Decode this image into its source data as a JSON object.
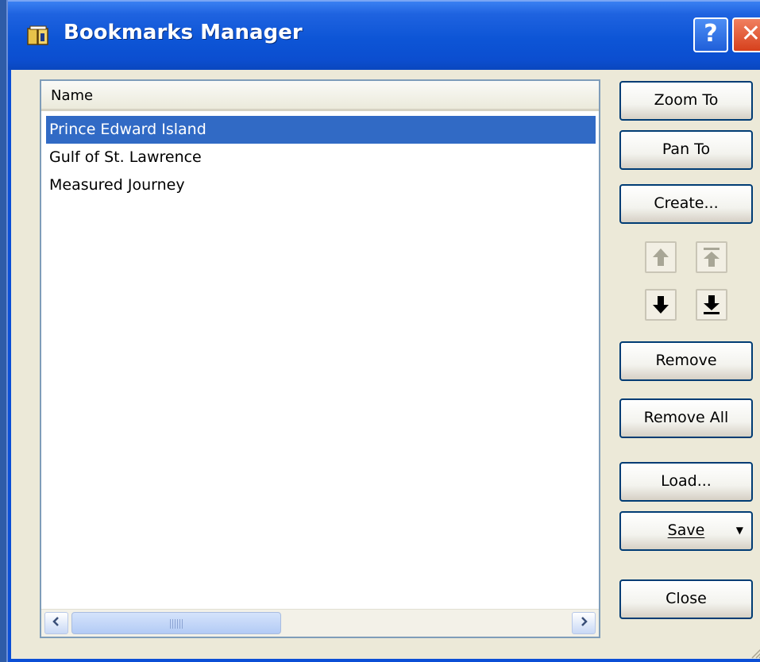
{
  "window": {
    "title": "Bookmarks Manager",
    "help_glyph": "?",
    "close_glyph": "✕"
  },
  "list": {
    "header": "Name",
    "items": [
      {
        "label": "Prince Edward Island",
        "selected": true
      },
      {
        "label": "Gulf of St. Lawrence",
        "selected": false
      },
      {
        "label": "Measured Journey",
        "selected": false
      }
    ]
  },
  "buttons": {
    "zoom_to": "Zoom To",
    "pan_to": "Pan To",
    "create": "Create...",
    "remove": "Remove",
    "remove_all": "Remove All",
    "load": "Load...",
    "save": "Save",
    "close": "Close"
  },
  "icons": {
    "move_up": "arrow-up-icon",
    "move_top": "arrow-top-icon",
    "move_down": "arrow-down-icon",
    "move_bottom": "arrow-bottom-icon"
  },
  "colors": {
    "title_bar": "#0c4ed0",
    "selection": "#316ac5",
    "dialog_bg": "#ece9d8",
    "close_button": "#d6401c",
    "disabled_arrow": "#a8a696"
  }
}
